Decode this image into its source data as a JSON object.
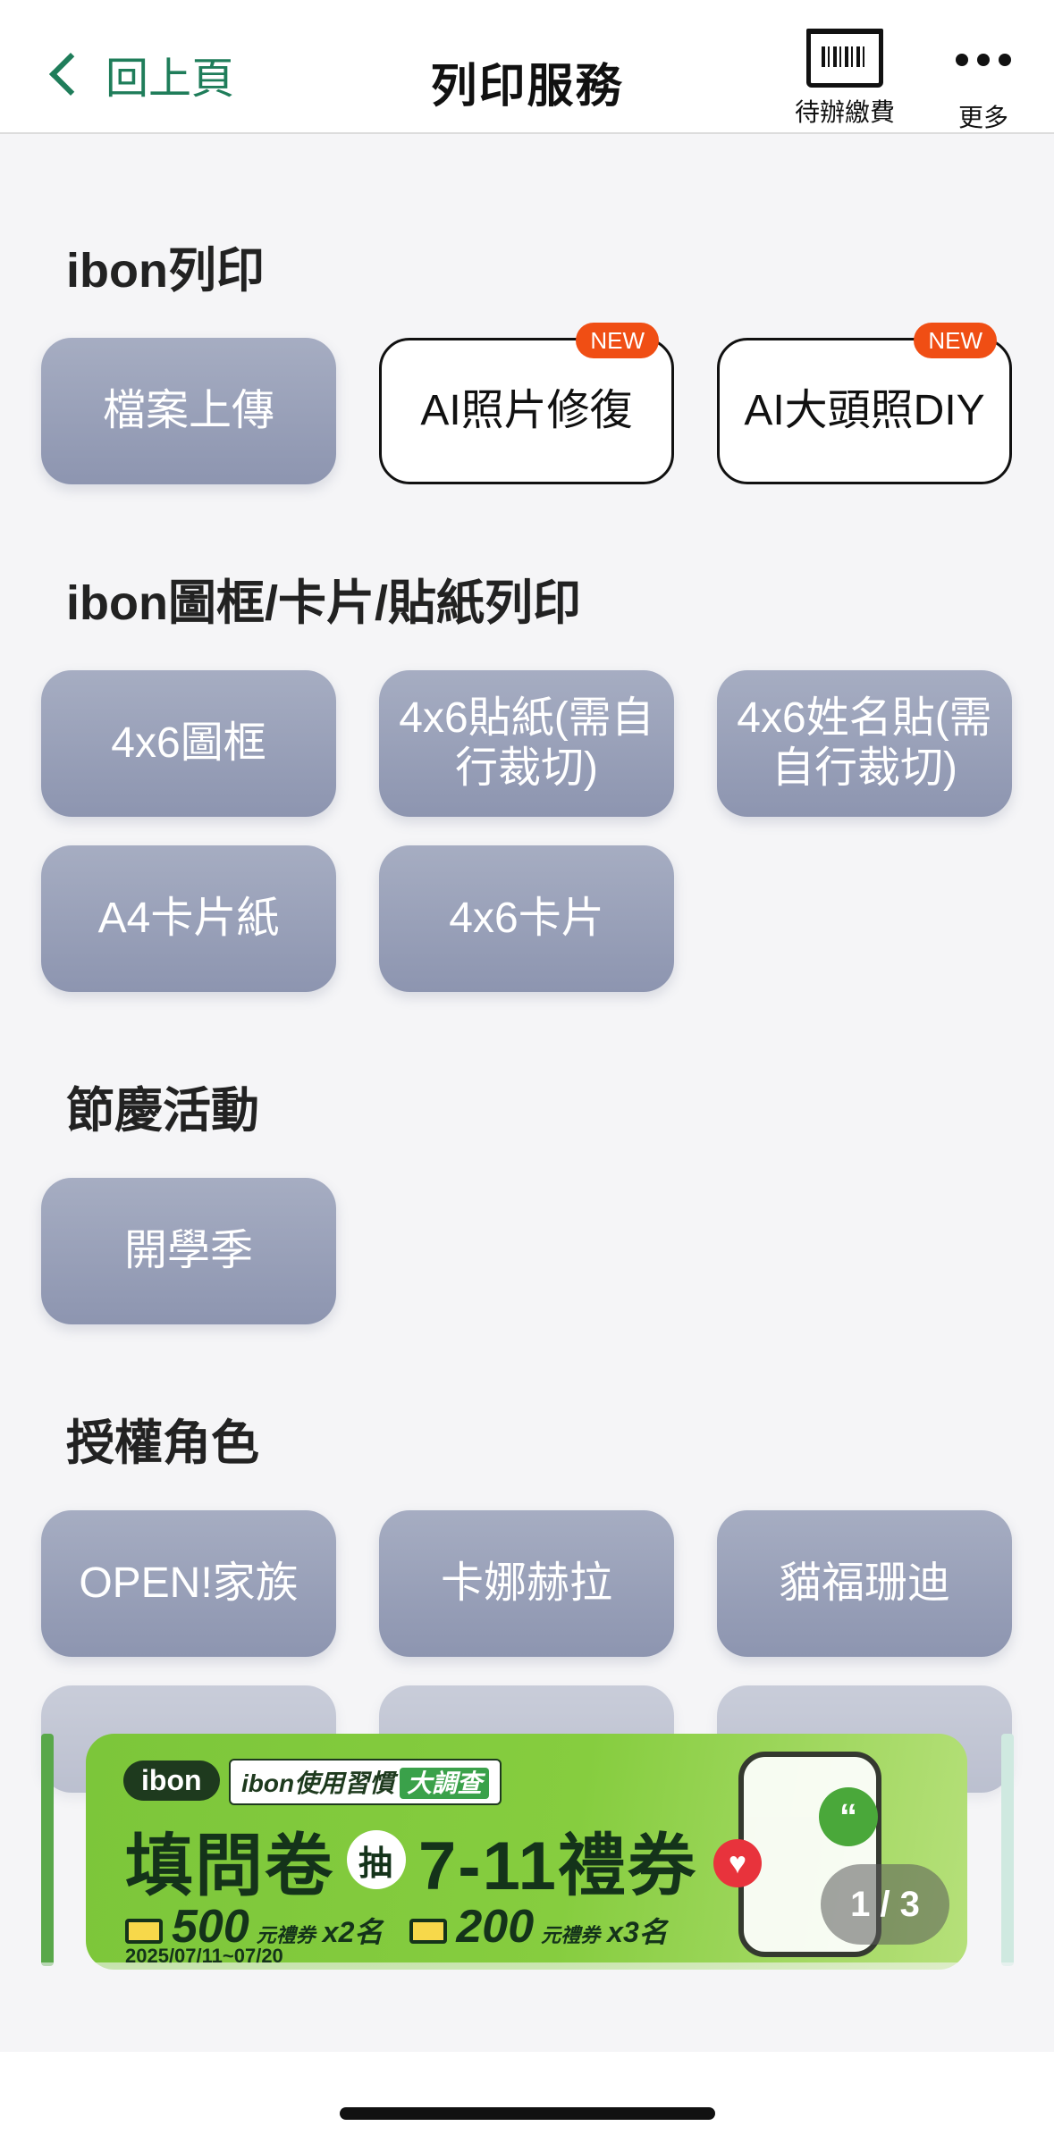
{
  "nav": {
    "back_label": "回上頁",
    "title": "列印服務",
    "pending_label": "待辦繳費",
    "more_label": "更多"
  },
  "sections": {
    "print": {
      "title": "ibon列印",
      "items": [
        {
          "label": "檔案上傳"
        },
        {
          "label": "AI照片修復",
          "badge": "NEW"
        },
        {
          "label": "AI大頭照DIY",
          "badge": "NEW"
        }
      ]
    },
    "frames": {
      "title": "ibon圖框/卡片/貼紙列印",
      "items": [
        {
          "label": "4x6圖框"
        },
        {
          "label": "4x6貼紙(需自行裁切)"
        },
        {
          "label": "4x6姓名貼(需自行裁切)"
        },
        {
          "label": "A4卡片紙"
        },
        {
          "label": "4x6卡片"
        }
      ]
    },
    "festival": {
      "title": "節慶活動",
      "items": [
        {
          "label": "開學季"
        }
      ]
    },
    "licensed": {
      "title": "授權角色",
      "items": [
        {
          "label": "OPEN!家族"
        },
        {
          "label": "卡娜赫拉"
        },
        {
          "label": "貓福珊迪"
        }
      ]
    }
  },
  "banner": {
    "logo": "ibon",
    "tag": "ibon使用習慣",
    "tag_highlight": "大調查",
    "headline_left": "填問卷",
    "headline_draw": "抽",
    "headline_right": "7-11禮券",
    "prize1_amount": "500",
    "prize1_unit": "元禮券",
    "prize1_count": "x2名",
    "prize2_amount": "200",
    "prize2_unit": "元禮券",
    "prize2_count": "x3名",
    "dates": "2025/07/11~07/20",
    "pager": "1 / 3",
    "colors": {
      "background": "#86cd3f",
      "text": "#14331a"
    }
  },
  "colors": {
    "accent": "#1f7d5a",
    "tile": "#9aa1bb",
    "badge": "#f04e14"
  }
}
